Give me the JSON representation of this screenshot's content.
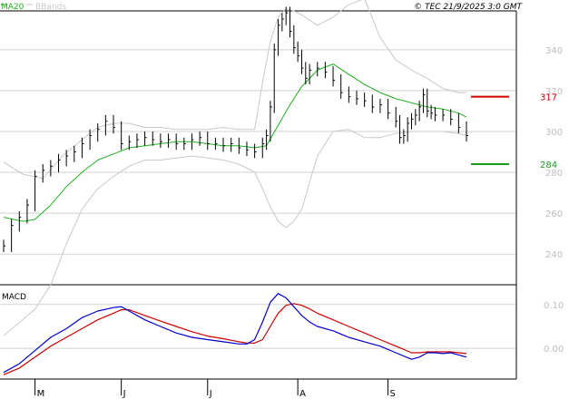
{
  "header": {
    "legend_ma": "MA20",
    "legend_bb": "BBands",
    "copyright": "© TEC 21/9/2025 3:0 GMT"
  },
  "colors": {
    "price": "#000000",
    "ma20": "#1fb01f",
    "bbands": "#c8c8c8",
    "resistance": "#cc0000",
    "support": "#1c9a1c",
    "macd": "#0000cc",
    "signal": "#cc0000",
    "grid": "#d2d2d2",
    "axis_text": "#bdbdbd"
  },
  "chart_data": [
    {
      "type": "line",
      "title": "",
      "ylim": [
        225,
        359
      ],
      "y_ticks": [
        240,
        260,
        280,
        300,
        320,
        340
      ],
      "x_tick_labels": [
        "M",
        "J",
        "J",
        "A",
        "S"
      ],
      "x_tick_sessions": [
        8,
        30,
        52,
        75,
        98
      ],
      "x_range": [
        0,
        127
      ],
      "series": [
        {
          "name": "MA20",
          "x": [
            0,
            5,
            8,
            12,
            16,
            20,
            24,
            28,
            32,
            36,
            40,
            44,
            48,
            52,
            56,
            60,
            64,
            67,
            70,
            73,
            76,
            80,
            84,
            88,
            92,
            96,
            100,
            104,
            108,
            112,
            116,
            118
          ],
          "values": [
            258,
            256,
            257,
            264,
            273,
            280,
            286,
            289,
            292,
            293,
            294,
            295,
            295,
            294,
            293,
            293,
            292,
            293,
            303,
            313,
            322,
            330,
            333,
            328,
            323,
            319,
            316,
            314,
            312,
            311,
            309,
            307
          ]
        },
        {
          "name": "BBands upper",
          "x": [
            0,
            5,
            10,
            15,
            20,
            24,
            28,
            32,
            36,
            40,
            44,
            48,
            52,
            56,
            60,
            64,
            66,
            68,
            70,
            72,
            74,
            76,
            80,
            84,
            88,
            92,
            96,
            100,
            104,
            108,
            112,
            116,
            118
          ],
          "values": [
            285,
            279,
            277,
            288,
            296,
            302,
            304,
            304,
            302,
            302,
            301,
            301,
            301,
            302,
            301,
            301,
            324,
            344,
            356,
            360,
            359,
            357,
            352,
            356,
            362,
            365,
            346,
            335,
            330,
            326,
            321,
            319,
            319
          ]
        },
        {
          "name": "BBands lower",
          "x": [
            0,
            8,
            12,
            16,
            20,
            24,
            28,
            32,
            36,
            40,
            44,
            48,
            52,
            56,
            60,
            64,
            66,
            68,
            70,
            72,
            74,
            76,
            80,
            84,
            88,
            92,
            96,
            100,
            104,
            108,
            112,
            116,
            118
          ],
          "values": [
            200,
            213,
            225,
            245,
            262,
            272,
            278,
            283,
            286,
            286,
            287,
            288,
            287,
            286,
            284,
            280,
            272,
            263,
            256,
            253,
            256,
            262,
            288,
            300,
            301,
            297,
            297,
            299,
            300,
            300,
            300,
            299,
            298
          ]
        },
        {
          "name": "Price",
          "x": [
            0,
            2,
            4,
            6,
            8,
            10,
            12,
            14,
            16,
            18,
            20,
            22,
            24,
            26,
            28,
            30,
            32,
            34,
            36,
            38,
            40,
            42,
            44,
            46,
            48,
            50,
            52,
            54,
            56,
            58,
            60,
            62,
            64,
            66,
            67,
            68,
            69,
            70,
            71,
            72,
            73,
            74,
            75,
            76,
            77,
            78,
            80,
            82,
            84,
            86,
            88,
            90,
            92,
            94,
            96,
            98,
            100,
            101,
            102,
            103,
            104,
            105,
            106,
            107,
            108,
            109,
            110,
            112,
            114,
            116,
            118
          ],
          "values": [
            244,
            254,
            258,
            264,
            278,
            281,
            283,
            286,
            288,
            290,
            294,
            298,
            301,
            305,
            302,
            294,
            295,
            296,
            297,
            296,
            295,
            296,
            294,
            294,
            296,
            297,
            294,
            294,
            293,
            294,
            292,
            291,
            290,
            294,
            298,
            312,
            340,
            352,
            355,
            358,
            349,
            341,
            337,
            331,
            326,
            330,
            331,
            329,
            325,
            319,
            317,
            316,
            315,
            312,
            313,
            309,
            305,
            297,
            298,
            304,
            306,
            308,
            312,
            318,
            310,
            309,
            308,
            308,
            306,
            302,
            298
          ]
        }
      ],
      "annotations": [
        {
          "label": "317",
          "value": 317,
          "kind": "resistance"
        },
        {
          "label": "284",
          "value": 284,
          "kind": "support"
        }
      ]
    },
    {
      "type": "line",
      "title": "MACD",
      "ylim": [
        -0.07,
        0.145
      ],
      "y_ticks": [
        0.0,
        0.1
      ],
      "y_tick_labels": [
        "0.00",
        "0.10"
      ],
      "series": [
        {
          "name": "",
          "x": [
            0,
            4,
            8,
            12,
            16,
            20,
            24,
            28,
            30,
            32,
            36,
            40,
            44,
            48,
            52,
            56,
            60,
            62,
            64,
            66,
            68,
            70,
            72,
            74,
            76,
            78,
            80,
            84,
            88,
            92,
            96,
            100,
            104,
            106,
            108,
            110,
            112,
            114,
            116,
            118
          ],
          "values": [
            -0.055,
            -0.035,
            -0.005,
            0.025,
            0.045,
            0.07,
            0.085,
            0.093,
            0.095,
            0.085,
            0.065,
            0.05,
            0.035,
            0.025,
            0.02,
            0.015,
            0.01,
            0.01,
            0.02,
            0.06,
            0.105,
            0.125,
            0.115,
            0.095,
            0.075,
            0.06,
            0.05,
            0.04,
            0.025,
            0.015,
            0.005,
            -0.01,
            -0.025,
            -0.02,
            -0.01,
            -0.01,
            -0.012,
            -0.01,
            -0.015,
            -0.02
          ]
        },
        {
          "name": "",
          "x": [
            0,
            4,
            8,
            12,
            16,
            20,
            24,
            28,
            30,
            32,
            36,
            40,
            44,
            48,
            52,
            56,
            60,
            62,
            64,
            66,
            68,
            70,
            72,
            74,
            76,
            78,
            80,
            84,
            88,
            92,
            96,
            100,
            104,
            106,
            108,
            110,
            112,
            114,
            116,
            118
          ],
          "values": [
            -0.06,
            -0.045,
            -0.02,
            0.005,
            0.025,
            0.045,
            0.065,
            0.08,
            0.088,
            0.088,
            0.075,
            0.062,
            0.05,
            0.038,
            0.028,
            0.022,
            0.015,
            0.012,
            0.012,
            0.02,
            0.05,
            0.08,
            0.098,
            0.102,
            0.098,
            0.09,
            0.08,
            0.065,
            0.05,
            0.035,
            0.02,
            0.005,
            -0.01,
            -0.01,
            -0.008,
            -0.008,
            -0.008,
            -0.008,
            -0.01,
            -0.012
          ]
        }
      ]
    }
  ]
}
